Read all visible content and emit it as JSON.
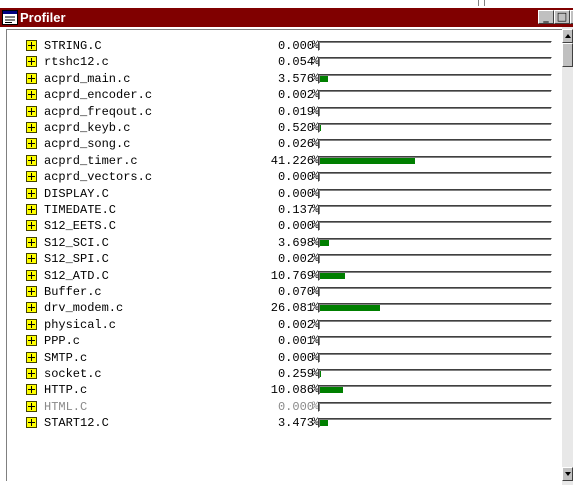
{
  "window": {
    "title": "Profiler",
    "title_bar_color": "#800000",
    "icon": "profiler-window-icon",
    "controls": {
      "minimize": "_",
      "maximize": "□",
      "close": "×"
    }
  },
  "profiler": {
    "unit": "%",
    "bar_color": "#007f00",
    "rows": [
      {
        "file": "STRING.C",
        "percent": "0.000",
        "value": 0.0,
        "dimmed": false
      },
      {
        "file": "rtshc12.c",
        "percent": "0.054",
        "value": 0.054,
        "dimmed": false
      },
      {
        "file": "acprd_main.c",
        "percent": "3.576",
        "value": 3.576,
        "dimmed": false
      },
      {
        "file": "acprd_encoder.c",
        "percent": "0.002",
        "value": 0.002,
        "dimmed": false
      },
      {
        "file": "acprd_freqout.c",
        "percent": "0.019",
        "value": 0.019,
        "dimmed": false
      },
      {
        "file": "acprd_keyb.c",
        "percent": "0.520",
        "value": 0.52,
        "dimmed": false
      },
      {
        "file": "acprd_song.c",
        "percent": "0.026",
        "value": 0.026,
        "dimmed": false
      },
      {
        "file": "acprd_timer.c",
        "percent": "41.226",
        "value": 41.226,
        "dimmed": false
      },
      {
        "file": "acprd_vectors.c",
        "percent": "0.000",
        "value": 0.0,
        "dimmed": false
      },
      {
        "file": "DISPLAY.C",
        "percent": "0.000",
        "value": 0.0,
        "dimmed": false
      },
      {
        "file": "TIMEDATE.C",
        "percent": "0.137",
        "value": 0.137,
        "dimmed": false
      },
      {
        "file": "S12_EETS.C",
        "percent": "0.000",
        "value": 0.0,
        "dimmed": false
      },
      {
        "file": "S12_SCI.C",
        "percent": "3.698",
        "value": 3.698,
        "dimmed": false
      },
      {
        "file": "S12_SPI.C",
        "percent": "0.002",
        "value": 0.002,
        "dimmed": false
      },
      {
        "file": "S12_ATD.C",
        "percent": "10.769",
        "value": 10.769,
        "dimmed": false
      },
      {
        "file": "Buffer.c",
        "percent": "0.070",
        "value": 0.07,
        "dimmed": false
      },
      {
        "file": "drv_modem.c",
        "percent": "26.081",
        "value": 26.081,
        "dimmed": false
      },
      {
        "file": "physical.c",
        "percent": "0.002",
        "value": 0.002,
        "dimmed": false
      },
      {
        "file": "PPP.c",
        "percent": "0.001",
        "value": 0.001,
        "dimmed": false
      },
      {
        "file": "SMTP.c",
        "percent": "0.000",
        "value": 0.0,
        "dimmed": false
      },
      {
        "file": "socket.c",
        "percent": "0.259",
        "value": 0.259,
        "dimmed": false
      },
      {
        "file": "HTTP.c",
        "percent": "10.086",
        "value": 10.086,
        "dimmed": false
      },
      {
        "file": "HTML.C",
        "percent": "0.000",
        "value": 0.0,
        "dimmed": true
      },
      {
        "file": "START12.C",
        "percent": "3.473",
        "value": 3.473,
        "dimmed": false
      }
    ]
  }
}
